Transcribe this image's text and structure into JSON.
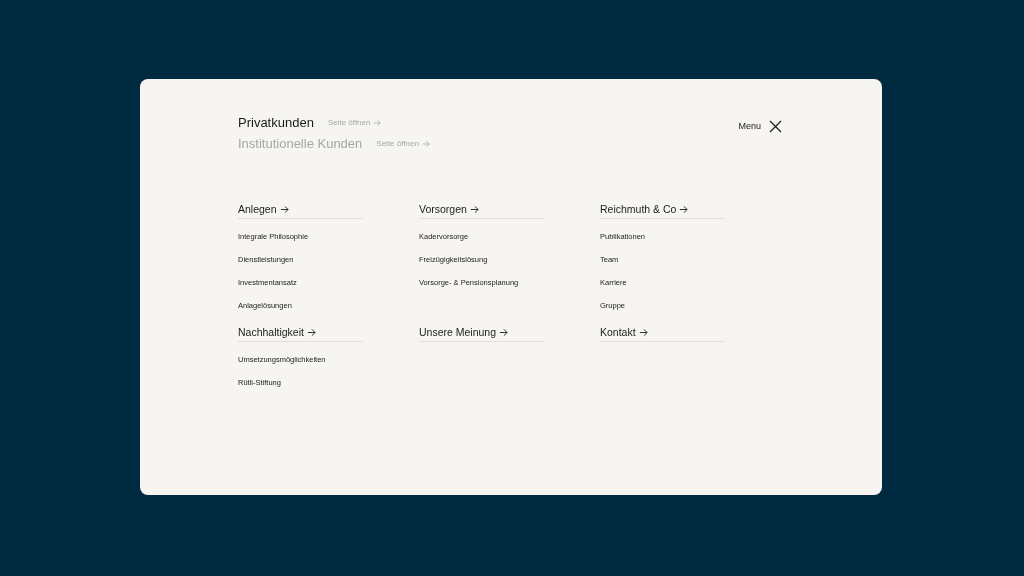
{
  "audiences": [
    {
      "label": "Privatkunden",
      "link": "Seite öffnen",
      "selected": true
    },
    {
      "label": "Institutionelle Kunden",
      "link": "Seite öffnen",
      "selected": false
    }
  ],
  "menu_button": {
    "label": "Menu"
  },
  "sections": [
    {
      "title": "Anlegen",
      "items": [
        "Integrale Philosophie",
        "Dienstleistungen",
        "Investmentansatz",
        "Anlagelösungen"
      ]
    },
    {
      "title": "Vorsorgen",
      "items": [
        "Kadervorsorge",
        "Freizügigkeitslösung",
        "Vorsorge- & Pensionsplanung"
      ]
    },
    {
      "title": "Reichmuth & Co",
      "items": [
        "Publikationen",
        "Team",
        "Karriere",
        "Gruppe"
      ]
    },
    {
      "title": "Nachhaltigkeit",
      "items": [
        "Umsetzungsmöglichkeiten",
        "Rütli-Stiftung"
      ]
    },
    {
      "title": "Unsere Meinung"
    },
    {
      "title": "Kontakt"
    }
  ]
}
